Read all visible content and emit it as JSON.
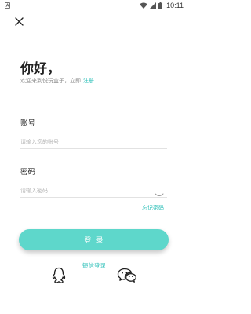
{
  "status_bar": {
    "app_badge": "A",
    "time": "10:11",
    "icons": [
      "wifi-icon",
      "signal-icon",
      "battery-icon"
    ]
  },
  "header": {
    "close_icon": "close-icon"
  },
  "greeting": {
    "title": "你好，",
    "welcome_text": "欢迎来到悦玩盒子，立即",
    "register_link": "注册"
  },
  "account": {
    "label": "账号",
    "placeholder": "请输入您的账号",
    "value": ""
  },
  "password": {
    "label": "密码",
    "placeholder": "请输入密码",
    "value": "",
    "toggle_icon": "eye-closed-icon",
    "forgot_link": "忘记密码"
  },
  "login_button": {
    "label": "登录"
  },
  "alt_login": {
    "sms_label": "短信登录",
    "icons": [
      "qq-icon",
      "wechat-icon"
    ]
  },
  "colors": {
    "accent": "#2fc0b9",
    "button": "#5ed7cb"
  }
}
